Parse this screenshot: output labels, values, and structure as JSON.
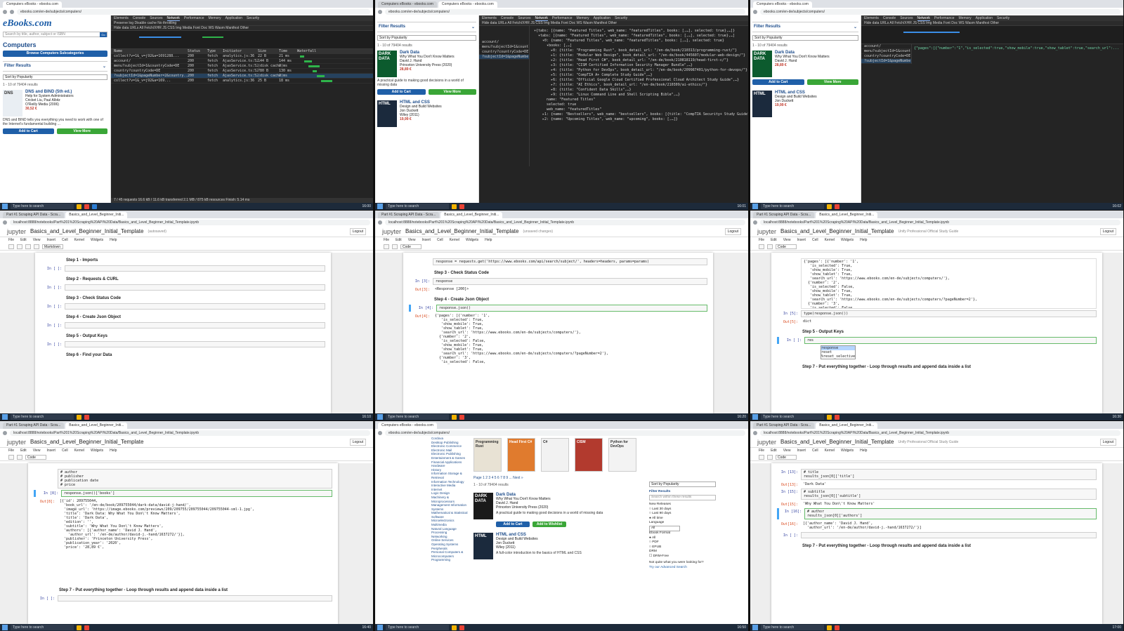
{
  "taskbar": {
    "search_placeholder": "Type here to search"
  },
  "ebooks": {
    "tab_title": "Computers eBooks - ebooks.com",
    "url": "ebooks.com/en-de/subjects/computers/",
    "logo": "eBooks.com",
    "search_placeholder": "Search by title, author, subject or ISBN",
    "go": "Go",
    "heading": "Computers",
    "browse_button": "Browse Computers Subcategories",
    "filter_label": "Filter Results",
    "sort": "Sort by Popularity",
    "count": "1 - 10 of 79404 results",
    "books": [
      {
        "title": "DNS and BIND (5th ed.)",
        "subtitle": "Help for System Administrators",
        "authors": "Cricket Liu, Paul Albitz",
        "publisher": "O'Reilly Media (2006)",
        "price": "30,52 €",
        "desc": "DNS and BIND tells you everything you need to work with one of the Internet's fundamental building ...",
        "cover": "DNS"
      },
      {
        "title": "Dark Data",
        "subtitle": "Why What You Don't Know Matters",
        "authors": "David J. Hand",
        "publisher": "Princeton University Press (2020)",
        "price": "28,89 €",
        "desc": "A practical guide to making good decisions in a world of missing data",
        "cover": "DARK DATA"
      },
      {
        "title": "HTML and CSS",
        "subtitle": "Design and Build Websites",
        "authors": "Jon Duckett",
        "publisher": "Wiley (2011)",
        "price": "19,99 €",
        "desc": "A full-color introduction to the basics of HTML and CSS",
        "cover": "HTML"
      }
    ],
    "add_to_cart": "Add to Cart",
    "view_more": "View More",
    "add_wishlist": "Add to Wishlist"
  },
  "devtools": {
    "tabs": [
      "Elements",
      "Console",
      "Sources",
      "Network",
      "Performance",
      "Memory",
      "Application",
      "Security"
    ],
    "active_tab": "Network",
    "filter_bar": "Preserve log   Disable cache   No throttling",
    "types_bar": "Hide data URLs  All  Fetch/XHR  JS  CSS  Img  Media  Font  Doc  WS  Wasm  Manifest  Other",
    "columns": [
      "Name",
      "Status",
      "Type",
      "Initiator",
      "Size",
      "Time",
      "Waterfall"
    ],
    "rows": [
      {
        "name": "collect?v=1&_v=j92&a=1691288...",
        "status": "200",
        "type": "fetch",
        "init": "analytics.js:36",
        "size": "22 B",
        "time": "21 ms"
      },
      {
        "name": "account/",
        "status": "200",
        "type": "fetch",
        "init": "AjaxService.ts:52",
        "size": "144 B",
        "time": "144 ms"
      },
      {
        "name": "menu?subjectId=1&countryCode=DE",
        "status": "200",
        "type": "fetch",
        "init": "AjaxService.ts:52",
        "size": "(disk cache)",
        "time": "2 ms"
      },
      {
        "name": "country?countryCode=DE",
        "status": "200",
        "type": "fetch",
        "init": "AjaxService.ts:52",
        "size": "780 B",
        "time": "130 ms"
      },
      {
        "name": "?subjectId=1&pageNumber=2&country...",
        "status": "200",
        "type": "fetch",
        "init": "AjaxService.ts:52",
        "size": "(disk cache)",
        "time": "2 ms"
      },
      {
        "name": "collect?v=1&_v=j92&a=169...",
        "status": "200",
        "type": "fetch",
        "init": "analytics.js:36",
        "size": "25 B",
        "time": "18 ms"
      }
    ],
    "footer": "7 / 45 requests   16.6 kB / 11.6 kB transferred   2.1 MB / 875 kB resources   Finish: 5.14 ms",
    "preview_lines": [
      "▾{tabs: [{name: \"Featured Titles\", web_name: \"featuredTitles\", books: [,…], selected: true},…]}",
      "  ▾tabs: [{name: \"Featured Titles\", web_name: \"featuredTitles\", books: [,…], selected: true},…]",
      "    ▾0: {name: \"Featured Titles\", web_name: \"featuredTitles\", books: [,…], selected: true}",
      "      ▾books: [,…]",
      "        ▸0: {title: \"Programming Rust\", book_detail_url: \"/en-de/book/210313/programming-rust/\"}",
      "        ▸1: {title: \"Modular Web Design\", book_detail_url: \"/en-de/book/445607/modular-web-design/\"}",
      "        ▸2: {title: \"Head First C#\", book_detail_url: \"/en-de/book/210818119/head-first-c/\"}",
      "        ▸3: {title: \"CISM Certified Information Security Manager Bundle\",…}",
      "        ▸4: {title: \"Python for DevOps\", book_detail_url: \"/en-de/book/209987401/python-for-devops/\"}",
      "        ▸5: {title: \"CompTIA A+ Complete Study Guide\",…}",
      "        ▸6: {title: \"Official Google Cloud Certified Professional Cloud Architect Study Guide\",…}",
      "        ▸7: {title: \"AI Ethics\", book_detail_url: \"/en-de/book/210309/ai-ethics/\"}",
      "        ▸8: {title: \"Confident Data Skills\",…}",
      "        ▸9: {title: \"Linux Command Line and Shell Scripting Bible\",…}",
      "      name: \"Featured Titles\"",
      "      selected: true",
      "      web_name: \"featuredTitles\"",
      "    ▸1: {name: \"Bestsellers\", web_name: \"bestsellers\", books: [{title: \"CompTIA Security+ Study Guide\",…}",
      "    ▸2: {name: \"Upcoming Titles\", web_name: \"upcoming\", books: [,…]}"
    ],
    "response_line": "{\"pages\":[{\"number\":\"1\",\"is_selected\":true,\"show_mobile\":true,\"show_tablet\":true,\"search_url\":..."
  },
  "jupyter": {
    "tab_title": "Basics_and_Level_Beginner_Initi...",
    "tab2_title": "Part #1 Scraping API Data - Scra...",
    "url": "localhost:8888/notebooks/Part%201%20Scraping%20API%20Data/Basics_and_Level_Beginner_Initial_Template.ipynb",
    "logo": "jupyter",
    "title": "Basics_and_Level_Beginner_Initial_Template",
    "save_status": "(autosaved)",
    "unsaved": "(unsaved changes)",
    "logout": "Logout",
    "kernel": "Python 3",
    "menu": [
      "File",
      "Edit",
      "View",
      "Insert",
      "Cell",
      "Kernel",
      "Widgets",
      "Help"
    ],
    "cell_type": "Markdown",
    "cell_type_code": "Code",
    "steps": [
      "Step 1 - Imports",
      "Step 2 - Requests & CURL",
      "Step 3 - Check Status Code",
      "Step 4 - Create Json Object",
      "Step 5 - Output Keys",
      "Step 6 - Find your Data",
      "Step 7 - Put everything together - Loop through results and append data inside a list"
    ],
    "code_request": "response = requests.get('https://www.ebooks.com/api/search/subject/', headers=headers, params=params)",
    "code_response": "response",
    "out_response": "<Response [200]>",
    "code_json": "response.json()",
    "out_json": "{'pages': [{'number': '1',\n   'is_selected': True,\n   'show_mobile': True,\n   'show_tablet': True,\n   'search_url': 'https://www.ebooks.com/en-de/subjects/computers/'},\n  {'number': '2',\n   'is_selected': False,\n   'show_mobile': True,\n   'show_tablet': True,\n   'search_url': 'https://www.ebooks.com/en-de/subjects/computers/?pageNumber=2'},\n  {'number': '3',\n   'is_selected': False,",
    "code_type": "type(response.json())",
    "out_type": "dict",
    "code_res": "res",
    "autocomplete": [
      "response",
      "reset",
      "%reset_selective"
    ],
    "out_books_head": "response.json()['books']",
    "out_books": "[{'id': 209755044,\n  'book_url': '/en-de/book/209755044/dark-data/david-j-hand/',\n  'image_url': 'https://image.ebooks.com/previews/209/209755/209755044/209755044-sml-1.jpg',\n  'title': 'Dark Data: Why What You Don\\'t Know Matters',\n  'title': 'Dark Data',\n  'edition': '',\n  'subtitle': 'Why What You Don\\'t Know Matters',\n  'authors': [{'author_name': 'David J. Hand',\n    'author_url': '/en-de/author/david-j.-hand/1637272/'}],\n  'publisher': 'Princeton University Press',\n  'publication_year': '2020',\n  'price': '28,89 €',",
    "code_title": "# title\nresults_json[0]['title']",
    "out_title": "'Dark Data'",
    "code_subtitle": "# subtitle\nresults_json[0]['subtitle']",
    "out_subtitle": "'Why What You Don\\'t Know Matters'",
    "code_author": "# author\nresults_json[0]['authors']",
    "out_author": "[{'author_name': 'David J. Hand',\n  'author_url': '/en-de/author/david-j.-hand/1637272/'}]",
    "comments": "# author\n# publisher\n# publication date\n# price",
    "popup": "Unify Professional Official Study Guide"
  },
  "ebooks_main": {
    "featured": [
      "Programming Rust",
      "Head First C#",
      "C#",
      "CISM",
      "Python for DevOps"
    ],
    "pagination": "Page  1  2  3  4  5  6  7  8  9  ...  Next »",
    "categories": [
      "Cordova",
      "Desktop Publishing",
      "Electronic Commerce",
      "Electronic Mail",
      "Electronic Publishing",
      "Entertainment & Games",
      "Financial Applications",
      "Hardware",
      "History",
      "Information Storage & Retrieval",
      "Information Technology",
      "Interactive Media",
      "Internet",
      "Logic Design",
      "Machinery & Microprocessors",
      "Management Information Systems",
      "Mathematical & Statistical Software",
      "Microelectronics",
      "Multimedia",
      "Natural Language Processing",
      "Networking",
      "Online Services",
      "Operating Systems",
      "Peripherals",
      "Personal Computers & Microcomputers",
      "Programming"
    ],
    "filter_results": "Filter Results",
    "filter_within": "Search within these results",
    "new_releases": "New Releases",
    "nr_options": [
      "Last 30 days",
      "Last 90 days",
      "All time"
    ],
    "language": "Language",
    "language_value": "All",
    "format": "Ebook Format",
    "format_options": [
      "All",
      "PDF",
      "EPUB"
    ],
    "drm": "DRM",
    "drm_option": "DRM-Free",
    "not_found": "Not quite what you were looking for?",
    "advanced": "Try our Advanced Search"
  }
}
